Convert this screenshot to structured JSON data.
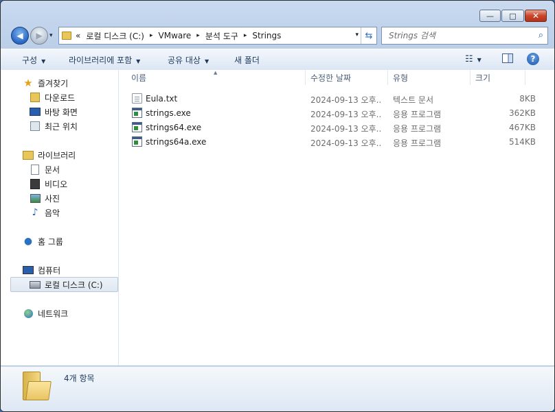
{
  "window": {
    "controls": {
      "minimize": "—",
      "maximize": "□",
      "close": "✕"
    }
  },
  "nav": {
    "back_glyph": "◀",
    "forward_glyph": "▶",
    "dropdown_glyph": "▾"
  },
  "address": {
    "overflow": "«",
    "crumbs": [
      "로컬 디스크 (C:)",
      "VMware",
      "분석 도구",
      "Strings"
    ],
    "separator": "▸",
    "dropdown_glyph": "▾",
    "refresh_glyph": "⇆"
  },
  "search": {
    "placeholder": "Strings 검색",
    "icon": "search-icon"
  },
  "toolbar": {
    "organize": "구성",
    "include_in_library": "라이브러리에 포함",
    "share_with": "공유 대상",
    "new_folder": "새 폴더",
    "views_glyph": "☷",
    "help_glyph": "?",
    "arrow": "▼"
  },
  "sidebar": {
    "favorites": {
      "label": "즐겨찾기",
      "items": [
        "다운로드",
        "바탕 화면",
        "최근 위치"
      ]
    },
    "libraries": {
      "label": "라이브러리",
      "items": [
        "문서",
        "비디오",
        "사진",
        "음악"
      ]
    },
    "homegroup": {
      "label": "홈 그룹"
    },
    "computer": {
      "label": "컴퓨터",
      "items": [
        "로컬 디스크 (C:)"
      ]
    },
    "network": {
      "label": "네트워크"
    }
  },
  "columns": {
    "name": "이름",
    "date": "수정한 날짜",
    "type": "유형",
    "size": "크기",
    "sort_glyph": "▲"
  },
  "files": [
    {
      "name": "Eula.txt",
      "date": "2024-09-13 오후...",
      "type": "텍스트 문서",
      "size": "8KB",
      "icon": "text-file-icon"
    },
    {
      "name": "strings.exe",
      "date": "2024-09-13 오후...",
      "type": "응용 프로그램",
      "size": "362KB",
      "icon": "exe-file-icon"
    },
    {
      "name": "strings64.exe",
      "date": "2024-09-13 오후...",
      "type": "응용 프로그램",
      "size": "467KB",
      "icon": "exe-file-icon"
    },
    {
      "name": "strings64a.exe",
      "date": "2024-09-13 오후...",
      "type": "응용 프로그램",
      "size": "514KB",
      "icon": "exe-file-icon"
    }
  ],
  "details": {
    "item_count": "4개 항목"
  }
}
